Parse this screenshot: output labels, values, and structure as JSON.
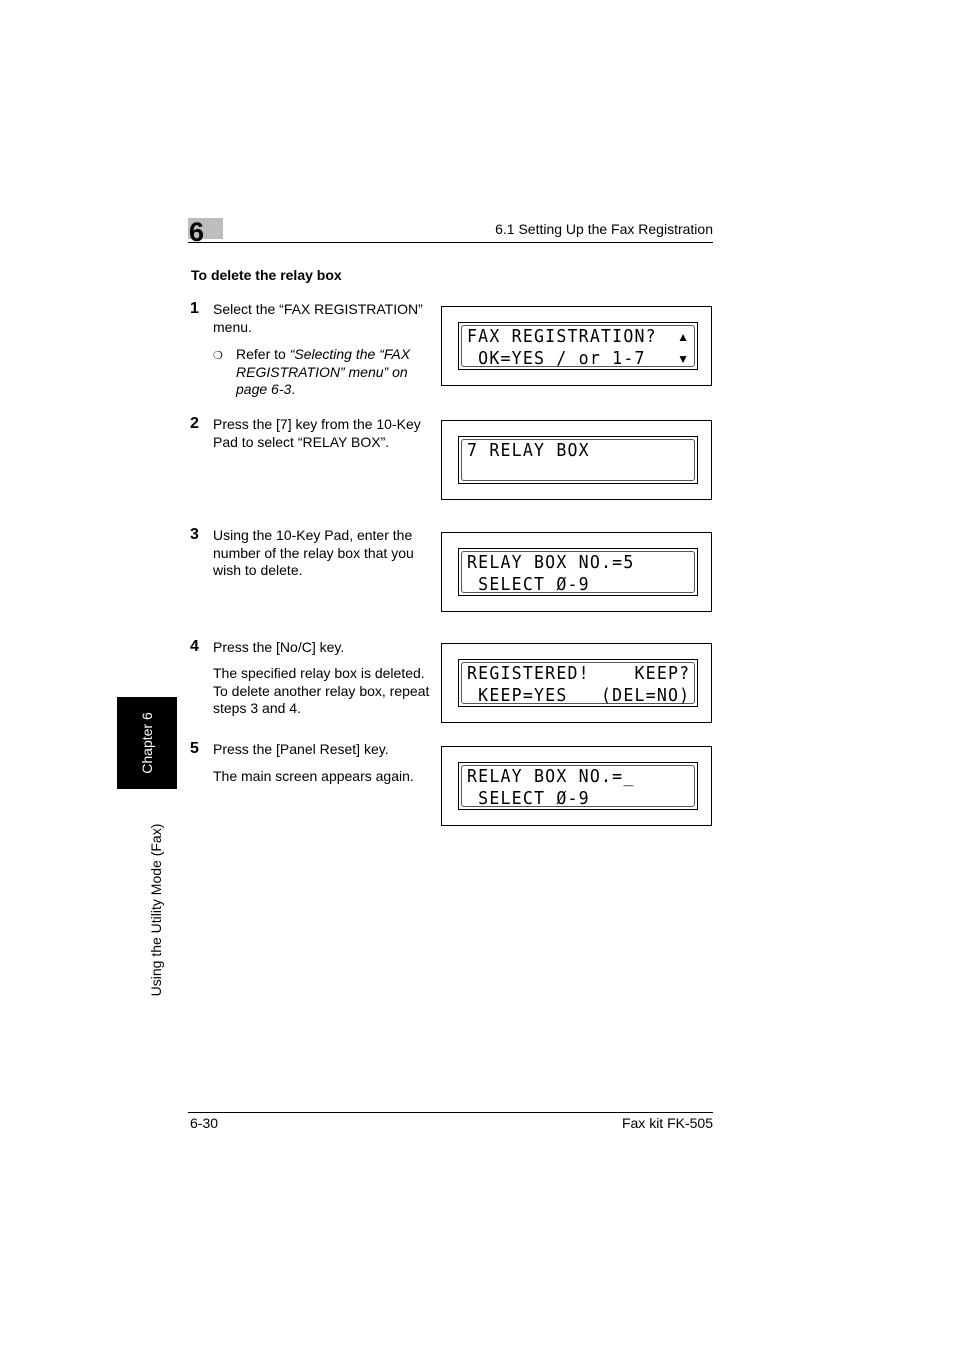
{
  "header": {
    "chapter_number": "6",
    "section_title": "6.1 Setting Up the Fax Registration"
  },
  "section_heading": "To delete the relay box",
  "steps": [
    {
      "number": "1",
      "text": "Select the “FAX REGISTRATION” menu.",
      "note": {
        "bullet": "❍",
        "prefix": "Refer to ",
        "link": "“Selecting the “FAX REGISTRATION” menu” on page 6-3",
        "suffix": "."
      },
      "lcd": {
        "line1": "FAX REGISTRATION?",
        "line2": " OK=YES / or 1-7",
        "arrow_up": "▲",
        "arrow_down": "▼"
      }
    },
    {
      "number": "2",
      "text": "Press the [7] key from the 10-Key Pad to select “RELAY BOX”.",
      "lcd": {
        "line1": "7 RELAY BOX",
        "line2": ""
      }
    },
    {
      "number": "3",
      "text": "Using the 10-Key Pad, enter the number of the relay box that you wish to delete.",
      "lcd": {
        "line1": "RELAY BOX NO.=5",
        "line2": " SELECT Ø-9"
      }
    },
    {
      "number": "4",
      "text": "Press the [No/C] key.",
      "detail": "The specified relay box is deleted. To delete another relay box, repeat steps 3 and 4.",
      "lcd": {
        "line1": "REGISTERED!    KEEP?",
        "line2": " KEEP=YES   (DEL=NO)"
      }
    },
    {
      "number": "5",
      "text": "Press the [Panel Reset] key.",
      "detail": "The main screen appears again.",
      "lcd": {
        "line1": "RELAY BOX NO.=_",
        "line2": " SELECT Ø-9"
      }
    }
  ],
  "side_tab": {
    "chapter": "Chapter 6",
    "mode": "Using the Utility Mode (Fax)"
  },
  "footer": {
    "page": "6-30",
    "product": "Fax kit FK-505"
  }
}
